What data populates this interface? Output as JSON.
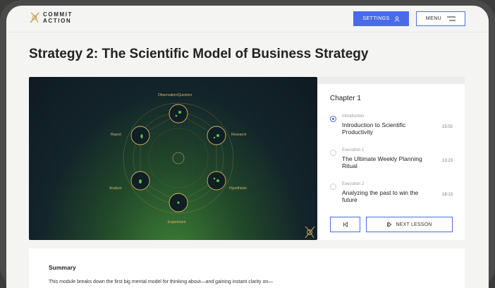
{
  "brand": {
    "line1": "COMMIT",
    "line2": "ACTION"
  },
  "header": {
    "settings_label": "SETTINGS",
    "menu_label": "MENU"
  },
  "page": {
    "title": "Strategy 2: The Scientific Model of Business Strategy"
  },
  "video": {
    "node_labels": [
      "Observation/Question",
      "Research",
      "Hypothesis",
      "Experiment",
      "Analyze",
      "Report"
    ]
  },
  "panel": {
    "chapter": "Chapter 1",
    "lessons": [
      {
        "kind": "Introduction",
        "name": "Introduction to Scientific Productivity",
        "duration": "15:02",
        "active": true
      },
      {
        "kind": "Execution 1",
        "name": "The Ultimate Weekly Planning Ritual",
        "duration": "13:23",
        "active": false
      },
      {
        "kind": "Execution 2",
        "name": "Analyzing the past to win the future",
        "duration": "18:13",
        "active": false
      }
    ],
    "next_label": "NEXT LESSON"
  },
  "summary": {
    "title": "Summary",
    "text": "This module breaks down the first big mental model for thinking about—and gaining instant clarity on—"
  },
  "colors": {
    "accent": "#4a6be8",
    "gold": "#d6b56a"
  }
}
